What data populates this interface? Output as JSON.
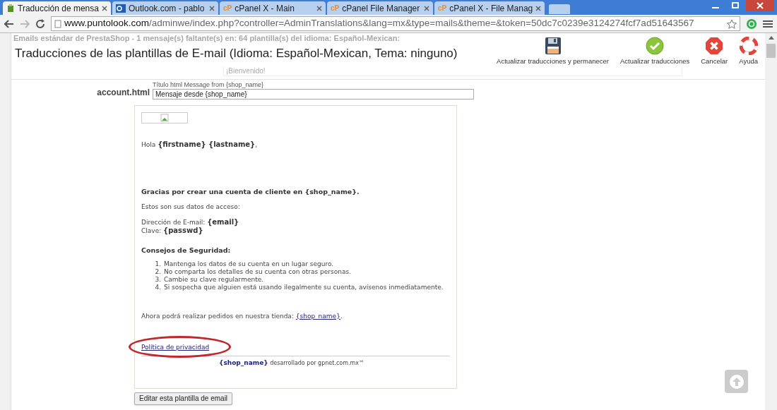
{
  "browser": {
    "tabs": [
      {
        "label": "Traducción de mensa",
        "kind": "shop",
        "selected": true
      },
      {
        "label": "Outlook.com - pablo",
        "kind": "mail",
        "selected": false
      },
      {
        "label": "cPanel X - Main",
        "kind": "logo",
        "logo": "cP",
        "selected": false
      },
      {
        "label": "cPanel File Manager",
        "kind": "logo",
        "logo": "cP",
        "selected": false
      },
      {
        "label": "cPanel X - File Manag",
        "kind": "logo",
        "logo": "cP",
        "selected": false
      }
    ],
    "url": {
      "host": "www.puntolook.com",
      "path": "/adminwe/index.php?controller=AdminTranslations&lang=mx&type=mails&theme=&token=50dc7c0239e3124274fcf7ad51643567"
    }
  },
  "page": {
    "notice": "Emails estándar de PrestaShop - 1 mensaje(s) faltante(s) en: 64 plantilla(s) del idioma: Español-Mexican:",
    "title": "Traducciones de las plantillas de E-mail (Idioma: Español-Mexican, Tema: ninguno)",
    "toolbar": [
      {
        "label": "Actualizar traducciones y permanecer",
        "kind": "save"
      },
      {
        "label": "Actualizar traducciones",
        "kind": "ok"
      },
      {
        "label": "Cancelar",
        "kind": "cancel"
      },
      {
        "label": "Ayuda",
        "kind": "help"
      }
    ],
    "subject_value": "¡Bienvenido!",
    "template": {
      "file": "account.html",
      "title_label": "Título html",
      "title_hint": "Message from {shop_name}",
      "title_value": "Mensaje desde {shop_name}"
    },
    "email": {
      "greeting": "Hola **{firstname} {lastname}**,",
      "thanks": "Gracias por crear una cuenta de cliente en {shop_name}.",
      "intro": "Estos son sus datos de acceso:",
      "credentials": [
        "Dirección de E-mail: **{email}**",
        "Clave: **{passwd}**"
      ],
      "tips_heading": "Consejos de Seguridad:",
      "tips": [
        {
          "number": "1.",
          "text": "Mantenga los datos de su cuenta en un lugar seguro."
        },
        {
          "number": "2.",
          "text": "No comparta los detalles de su cuenta con otras personas."
        },
        {
          "number": "3.",
          "text": "Cambie su clave regularmente."
        },
        {
          "number": "4.",
          "text": "Si sospecha que alguien está usando ilegalmente su cuenta, avísenos inmediatamente."
        }
      ],
      "shop_line_before": "Ahora podrá realizar pedidos en nuestra tienda: ",
      "shop_link": "{shop_name}",
      "shop_line_after": ".",
      "privacy_link": "Política de privacidad",
      "privacy_highlighted": true,
      "footer": "**{shop_name}** desarrollado por gpnet.com.mx™"
    },
    "edit_button": "Editar esta plantilla de email"
  }
}
